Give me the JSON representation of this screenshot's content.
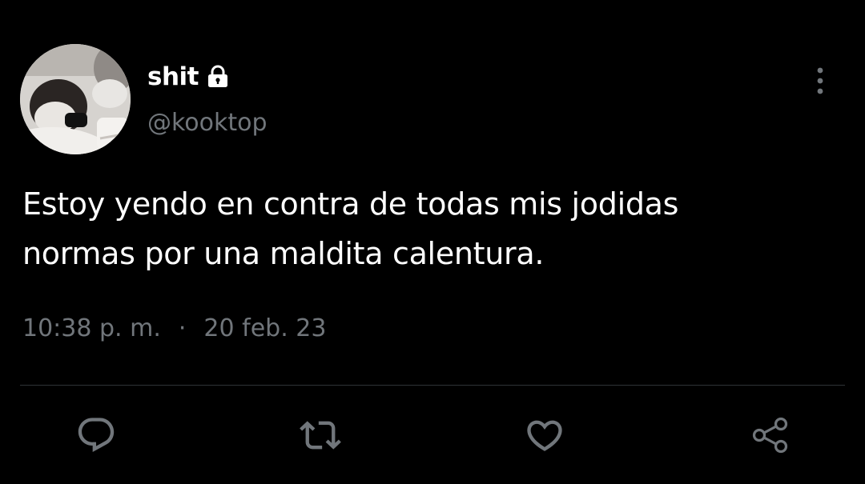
{
  "author": {
    "display_name": "shit",
    "handle": "@kooktop",
    "protected_icon": "lock-icon",
    "avatar_icon": "avatar"
  },
  "tweet": {
    "text_line1": "Estoy yendo en contra de todas mis jodidas",
    "text_line2": "normas por una maldita calentura.",
    "time": "10:38 p. m.",
    "separator": "·",
    "date": "20 feb. 23"
  },
  "actions": {
    "more_icon": "more-vertical-icon",
    "reply_icon": "reply-icon",
    "retweet_icon": "retweet-icon",
    "like_icon": "heart-icon",
    "share_icon": "share-icon"
  },
  "colors": {
    "background": "#000000",
    "text": "#ffffff",
    "secondary": "#71767b",
    "divider": "#2f3336"
  }
}
